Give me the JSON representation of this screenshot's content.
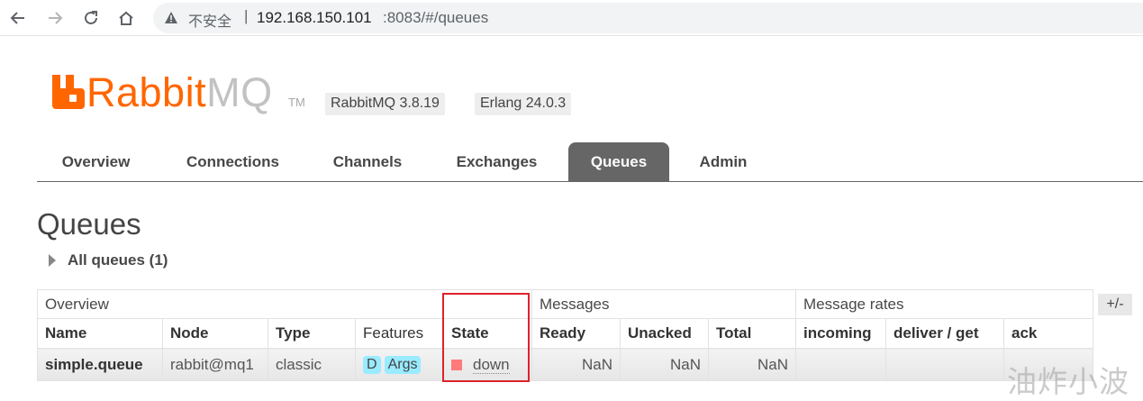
{
  "browser": {
    "security_label": "不安全",
    "url_host": "192.168.150.101",
    "url_rest": ":8083/#/queues"
  },
  "brand": {
    "logo_rabbit": "Rabbit",
    "logo_mq": "MQ",
    "logo_tm": "TM",
    "rabbitmq_version": "RabbitMQ 3.8.19",
    "erlang_version": "Erlang 24.0.3",
    "accent_color": "#ff6600"
  },
  "nav": {
    "tabs": [
      {
        "label": "Overview",
        "active": false
      },
      {
        "label": "Connections",
        "active": false
      },
      {
        "label": "Channels",
        "active": false
      },
      {
        "label": "Exchanges",
        "active": false
      },
      {
        "label": "Queues",
        "active": true
      },
      {
        "label": "Admin",
        "active": false
      }
    ]
  },
  "page": {
    "title": "Queues",
    "section_label": "All queues (1)"
  },
  "table": {
    "groups": {
      "overview": "Overview",
      "messages": "Messages",
      "message_rates": "Message rates"
    },
    "columns": {
      "name": "Name",
      "node": "Node",
      "type": "Type",
      "features": "Features",
      "state": "State",
      "ready": "Ready",
      "unacked": "Unacked",
      "total": "Total",
      "incoming": "incoming",
      "deliver_get": "deliver / get",
      "ack": "ack"
    },
    "rows": [
      {
        "name": "simple.queue",
        "node": "rabbit@mq1",
        "type": "classic",
        "feature_d": "D",
        "feature_args": "Args",
        "state": "down",
        "ready": "NaN",
        "unacked": "NaN",
        "total": "NaN",
        "incoming": "",
        "deliver_get": "",
        "ack": ""
      }
    ],
    "toggle_columns": "+/-"
  },
  "watermark": "油炸小波",
  "colors": {
    "state_down": "#ff7a7a",
    "feature_badge": "#99ebff",
    "highlight": "#e0212b"
  }
}
